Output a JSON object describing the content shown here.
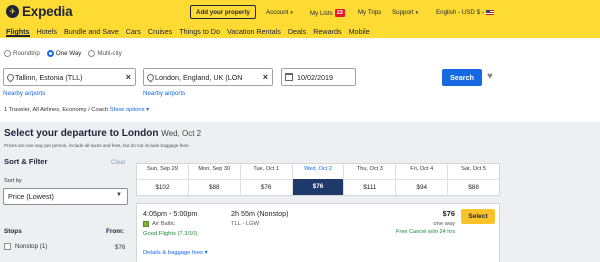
{
  "header": {
    "logo_text": "Expedia",
    "add_property": "Add your property",
    "account": "Account",
    "my_lists": "My Lists",
    "my_lists_count": "23",
    "my_trips": "My Trips",
    "support": "Support",
    "locale": "English - USD $ -",
    "accent_color": "#fddb32",
    "brand_color": "#1e243a"
  },
  "nav": {
    "items": [
      "Flights",
      "Hotels",
      "Bundle and Save",
      "Cars",
      "Cruises",
      "Things to Do",
      "Vacation Rentals",
      "Deals",
      "Rewards",
      "Mobile"
    ],
    "active": "Flights"
  },
  "search": {
    "trip_types": [
      "Roundtrip",
      "One Way",
      "Multi-city"
    ],
    "selected_trip_type": "One Way",
    "origin": "Tallinn, Estonia (TLL)",
    "destination": "London, England, UK (LON",
    "date": "10/02/2019",
    "nearby_origin": "Nearby airports",
    "nearby_destination": "Nearby airports",
    "search_label": "Search",
    "travelers_text": "1 Traveler, All Airlines, Economy / Coach",
    "show_options": "Show options"
  },
  "results": {
    "title": "Select your departure to London",
    "title_date": "Wed, Oct 2",
    "disclaimer": "Prices are one way per person, include all taxes and fees, but do not include baggage fees.",
    "sort_filter": "Sort & Filter",
    "clear": "Clear",
    "sort_by": "Sort by",
    "sort_value": "Price (Lowest)",
    "stops_label": "Stops",
    "from_label": "From:",
    "stop_option": "Nonstop (1)",
    "stop_price": "$76"
  },
  "date_strip": [
    {
      "date": "Sun, Sep 29",
      "price": "$102"
    },
    {
      "date": "Mon, Sep 30",
      "price": "$88"
    },
    {
      "date": "Tue, Oct 1",
      "price": "$76"
    },
    {
      "date": "Wed, Oct 2",
      "price": "$76",
      "selected": true
    },
    {
      "date": "Thu, Oct 3",
      "price": "$111"
    },
    {
      "date": "Fri, Oct 4",
      "price": "$94"
    },
    {
      "date": "Sat, Oct 5",
      "price": "$88"
    }
  ],
  "flight": {
    "times": "4:05pm - 5:00pm",
    "airline": "Air Baltic",
    "rating": "Good Flights (7.3/10)",
    "details_link": "Details & baggage fees",
    "duration": "2h 55m (Nonstop)",
    "route": "TLL - LGW",
    "price": "$76",
    "way": "one way",
    "free_cancel": "Free Cancel w/in 24 hrs",
    "select_label": "Select"
  }
}
